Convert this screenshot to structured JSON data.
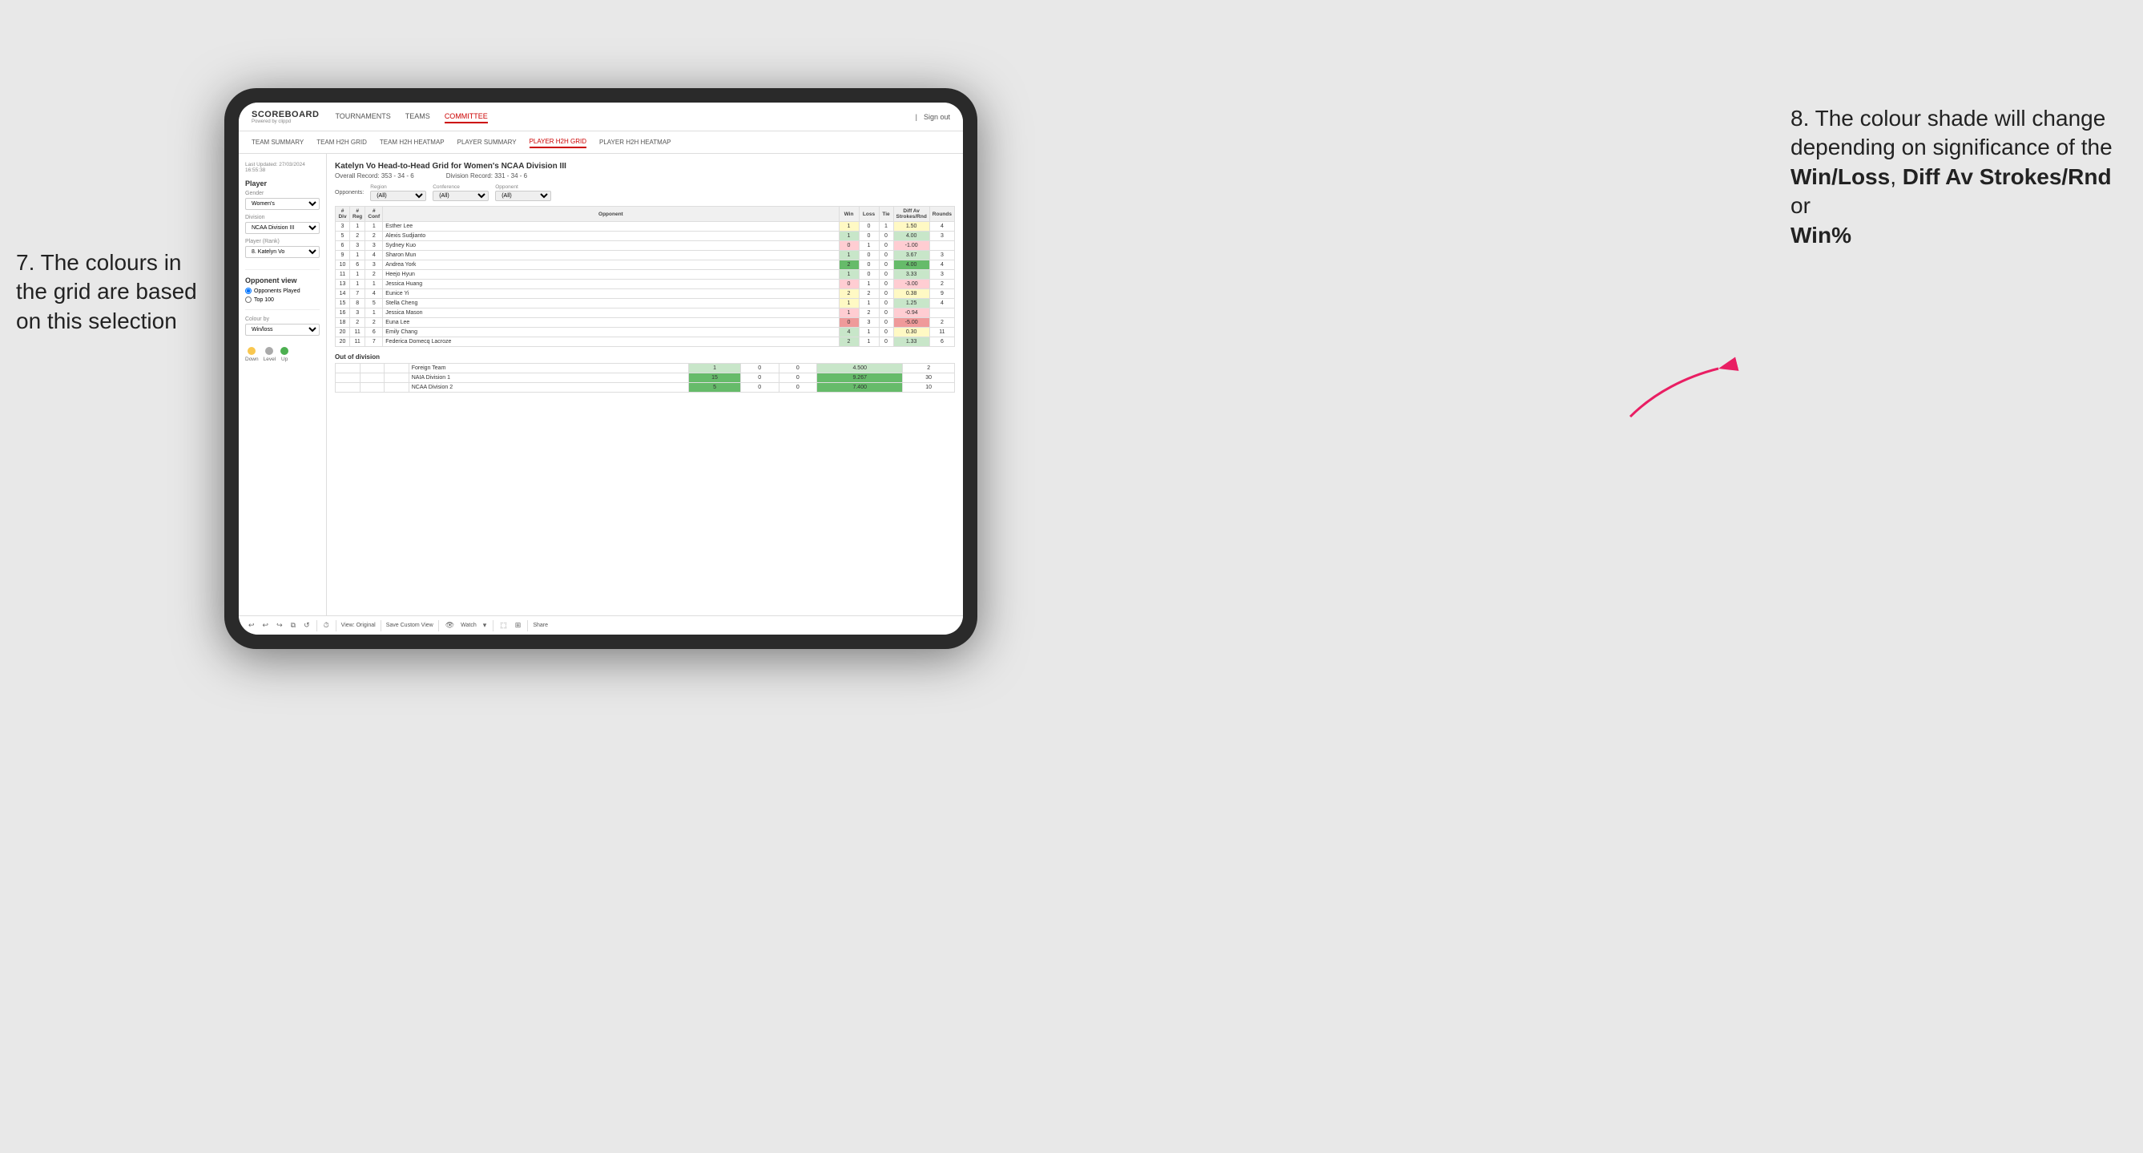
{
  "annotations": {
    "left_title": "7. The colours in the grid are based on this selection",
    "right_title": "8. The colour shade will change depending on significance of the",
    "right_bold1": "Win/Loss",
    "right_sep1": ", ",
    "right_bold2": "Diff Av Strokes/Rnd",
    "right_sep2": " or",
    "right_bold3": "Win%"
  },
  "nav": {
    "logo": "SCOREBOARD",
    "logo_sub": "Powered by clippd",
    "links": [
      "TOURNAMENTS",
      "TEAMS",
      "COMMITTEE"
    ],
    "active_link": "COMMITTEE",
    "right_sign_in": "Sign out"
  },
  "sub_nav": {
    "links": [
      "TEAM SUMMARY",
      "TEAM H2H GRID",
      "TEAM H2H HEATMAP",
      "PLAYER SUMMARY",
      "PLAYER H2H GRID",
      "PLAYER H2H HEATMAP"
    ],
    "active": "PLAYER H2H GRID"
  },
  "sidebar": {
    "last_updated_label": "Last Updated: 27/03/2024",
    "last_updated_time": "16:55:38",
    "section_title": "Player",
    "gender_label": "Gender",
    "gender_value": "Women's",
    "division_label": "Division",
    "division_value": "NCAA Division III",
    "player_rank_label": "Player (Rank)",
    "player_rank_value": "8. Katelyn Vo",
    "opponent_view_label": "Opponent view",
    "radio1": "Opponents Played",
    "radio2": "Top 100",
    "colour_by_label": "Colour by",
    "colour_by_value": "Win/loss",
    "legend": {
      "down_label": "Down",
      "level_label": "Level",
      "up_label": "Up"
    }
  },
  "grid": {
    "title": "Katelyn Vo Head-to-Head Grid for Women's NCAA Division III",
    "overall_record_label": "Overall Record:",
    "overall_record": "353 - 34 - 6",
    "division_record_label": "Division Record:",
    "division_record": "331 - 34 - 6",
    "filters": {
      "opponents_label": "Opponents:",
      "region_label": "Region",
      "region_value": "(All)",
      "conference_label": "Conference",
      "conference_value": "(All)",
      "opponent_label": "Opponent",
      "opponent_value": "(All)"
    },
    "table_headers": {
      "div": "#\nDiv",
      "reg": "#\nReg",
      "conf": "#\nConf",
      "opponent": "Opponent",
      "win": "Win",
      "loss": "Loss",
      "tie": "Tie",
      "diff": "Diff Av\nStrokes/Rnd",
      "rounds": "Rounds"
    },
    "rows": [
      {
        "div": "3",
        "reg": "1",
        "conf": "1",
        "name": "Esther Lee",
        "win": 1,
        "loss": 0,
        "tie": 1,
        "diff": "1.50",
        "rounds": "4",
        "win_color": "yellow",
        "diff_color": "yellow"
      },
      {
        "div": "5",
        "reg": "2",
        "conf": "2",
        "name": "Alexis Sudjianto",
        "win": 1,
        "loss": 0,
        "tie": 0,
        "diff": "4.00",
        "rounds": "3",
        "win_color": "green-light",
        "diff_color": "green-light"
      },
      {
        "div": "6",
        "reg": "3",
        "conf": "3",
        "name": "Sydney Kuo",
        "win": 0,
        "loss": 1,
        "tie": 0,
        "diff": "-1.00",
        "rounds": "",
        "win_color": "red-light",
        "diff_color": "red-light"
      },
      {
        "div": "9",
        "reg": "1",
        "conf": "4",
        "name": "Sharon Mun",
        "win": 1,
        "loss": 0,
        "tie": 0,
        "diff": "3.67",
        "rounds": "3",
        "win_color": "green-light",
        "diff_color": "green-light"
      },
      {
        "div": "10",
        "reg": "6",
        "conf": "3",
        "name": "Andrea York",
        "win": 2,
        "loss": 0,
        "tie": 0,
        "diff": "4.00",
        "rounds": "4",
        "win_color": "green-dark",
        "diff_color": "green-dark"
      },
      {
        "div": "11",
        "reg": "1",
        "conf": "2",
        "name": "Heejo Hyun",
        "win": 1,
        "loss": 0,
        "tie": 0,
        "diff": "3.33",
        "rounds": "3",
        "win_color": "green-light",
        "diff_color": "green-light"
      },
      {
        "div": "13",
        "reg": "1",
        "conf": "1",
        "name": "Jessica Huang",
        "win": 0,
        "loss": 1,
        "tie": 0,
        "diff": "-3.00",
        "rounds": "2",
        "win_color": "red-light",
        "diff_color": "red-light"
      },
      {
        "div": "14",
        "reg": "7",
        "conf": "4",
        "name": "Eunice Yi",
        "win": 2,
        "loss": 2,
        "tie": 0,
        "diff": "0.38",
        "rounds": "9",
        "win_color": "yellow",
        "diff_color": "yellow"
      },
      {
        "div": "15",
        "reg": "8",
        "conf": "5",
        "name": "Stella Cheng",
        "win": 1,
        "loss": 1,
        "tie": 0,
        "diff": "1.25",
        "rounds": "4",
        "win_color": "yellow",
        "diff_color": "green-light"
      },
      {
        "div": "16",
        "reg": "3",
        "conf": "1",
        "name": "Jessica Mason",
        "win": 1,
        "loss": 2,
        "tie": 0,
        "diff": "-0.94",
        "rounds": "",
        "win_color": "red-light",
        "diff_color": "red-light"
      },
      {
        "div": "18",
        "reg": "2",
        "conf": "2",
        "name": "Euna Lee",
        "win": 0,
        "loss": 3,
        "tie": 0,
        "diff": "-5.00",
        "rounds": "2",
        "win_color": "red-dark",
        "diff_color": "red-dark"
      },
      {
        "div": "20",
        "reg": "11",
        "conf": "6",
        "name": "Emily Chang",
        "win": 4,
        "loss": 1,
        "tie": 0,
        "diff": "0.30",
        "rounds": "11",
        "win_color": "green-light",
        "diff_color": "yellow"
      },
      {
        "div": "20",
        "reg": "11",
        "conf": "7",
        "name": "Federica Domecq Lacroze",
        "win": 2,
        "loss": 1,
        "tie": 0,
        "diff": "1.33",
        "rounds": "6",
        "win_color": "green-light",
        "diff_color": "green-light"
      }
    ],
    "out_of_division_label": "Out of division",
    "out_of_division_rows": [
      {
        "name": "Foreign Team",
        "win": 1,
        "loss": 0,
        "tie": 0,
        "diff": "4.500",
        "rounds": "2",
        "win_color": "green-light",
        "diff_color": "green-light"
      },
      {
        "name": "NAIA Division 1",
        "win": 15,
        "loss": 0,
        "tie": 0,
        "diff": "9.267",
        "rounds": "30",
        "win_color": "green-dark",
        "diff_color": "green-dark"
      },
      {
        "name": "NCAA Division 2",
        "win": 5,
        "loss": 0,
        "tie": 0,
        "diff": "7.400",
        "rounds": "10",
        "win_color": "green-dark",
        "diff_color": "green-dark"
      }
    ]
  },
  "toolbar": {
    "undo": "↩",
    "redo": "↪",
    "view_original": "View: Original",
    "save_custom": "Save Custom View",
    "watch": "Watch",
    "share": "Share"
  }
}
